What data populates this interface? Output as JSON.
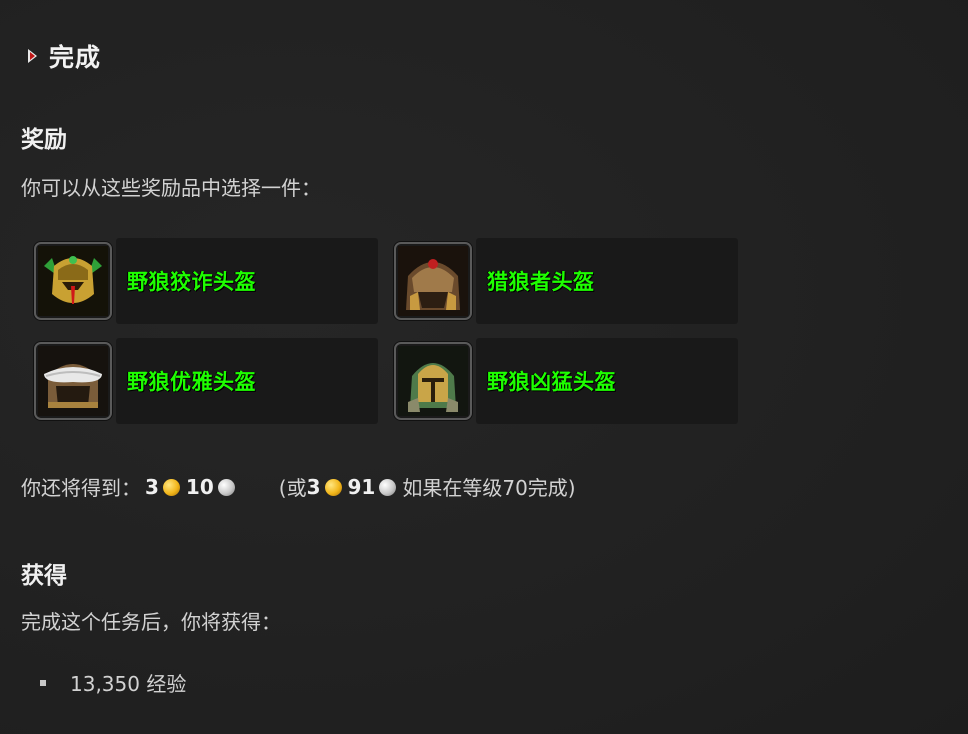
{
  "header": {
    "title": "完成"
  },
  "rewards": {
    "heading": "奖励",
    "intro": "你可以从这些奖励品中选择一件：",
    "items": [
      {
        "name": "野狼狡诈头盔",
        "icon": "gold-horned-helm-icon"
      },
      {
        "name": "猎狼者头盔",
        "icon": "wolf-hood-helm-icon"
      },
      {
        "name": "野狼优雅头盔",
        "icon": "fur-trim-helm-icon"
      },
      {
        "name": "野狼凶猛头盔",
        "icon": "green-plate-helm-icon"
      }
    ]
  },
  "money": {
    "label": "你还将得到：",
    "gold": "3",
    "silver": "10",
    "alt_open": "(或",
    "alt_gold": "3",
    "alt_silver": "91",
    "alt_suffix": "如果在等级70完成)"
  },
  "gains": {
    "heading": "获得",
    "intro": "完成这个任务后，你将获得：",
    "items": [
      "13,350 经验"
    ]
  },
  "colors": {
    "item_quality_green": "#1eff00",
    "background": "#212121"
  }
}
